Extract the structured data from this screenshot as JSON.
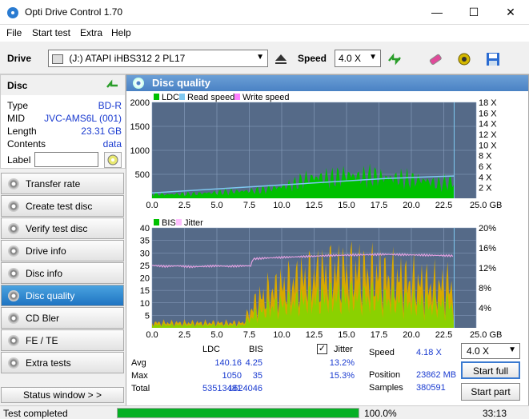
{
  "window": {
    "title": "Opti Drive Control 1.70"
  },
  "menu": [
    "File",
    "Start test",
    "Extra",
    "Help"
  ],
  "toolbar": {
    "drive_label": "Drive",
    "drive_value": "(J:)  ATAPI iHBS312  2 PL17",
    "speed_label": "Speed",
    "speed_value": "4.0 X"
  },
  "disc": {
    "header": "Disc",
    "rows": [
      {
        "k": "Type",
        "v": "BD-R"
      },
      {
        "k": "MID",
        "v": "JVC-AMS6L (001)"
      },
      {
        "k": "Length",
        "v": "23.31 GB"
      },
      {
        "k": "Contents",
        "v": "data"
      }
    ],
    "label_key": "Label",
    "label_value": ""
  },
  "nav": [
    {
      "label": "Transfer rate",
      "active": false
    },
    {
      "label": "Create test disc",
      "active": false
    },
    {
      "label": "Verify test disc",
      "active": false
    },
    {
      "label": "Drive info",
      "active": false
    },
    {
      "label": "Disc info",
      "active": false
    },
    {
      "label": "Disc quality",
      "active": true
    },
    {
      "label": "CD Bler",
      "active": false
    },
    {
      "label": "FE / TE",
      "active": false
    },
    {
      "label": "Extra tests",
      "active": false
    }
  ],
  "status_window_label": "Status window > >",
  "panel_title": "Disc quality",
  "chart_data": [
    {
      "type": "area",
      "legend": [
        "LDC",
        "Read speed",
        "Write speed"
      ],
      "x_ticks": [
        "0.0",
        "2.5",
        "5.0",
        "7.5",
        "10.0",
        "12.5",
        "15.0",
        "17.5",
        "20.0",
        "22.5",
        "25.0 GB"
      ],
      "y_ticks_left": [
        "2000",
        "1500",
        "1000",
        "500"
      ],
      "y_ticks_right": [
        "18 X",
        "16 X",
        "14 X",
        "12 X",
        "10 X",
        "8 X",
        "6 X",
        "4 X",
        "2 X"
      ],
      "xlim": [
        0,
        25
      ],
      "ylim": [
        0,
        2000
      ],
      "y2lim": [
        0,
        18
      ],
      "series": [
        {
          "name": "LDC",
          "color": "#00c000",
          "x": [
            0,
            1,
            2,
            3,
            4,
            5,
            6,
            7,
            8,
            9,
            10,
            11,
            12,
            13,
            14,
            15,
            16,
            17,
            18,
            19,
            20,
            21,
            22,
            23.3
          ],
          "values": [
            100,
            80,
            90,
            90,
            110,
            120,
            140,
            150,
            160,
            200,
            240,
            300,
            420,
            440,
            420,
            500,
            450,
            470,
            430,
            420,
            390,
            380,
            300,
            350
          ]
        },
        {
          "name": "Read speed",
          "color": "#7ec8f0",
          "x": [
            0,
            2,
            4,
            6,
            8,
            10,
            12,
            14,
            16,
            18,
            20,
            22,
            23.3
          ],
          "values": [
            1.0,
            1.3,
            1.6,
            1.9,
            2.2,
            2.5,
            2.8,
            3.1,
            3.4,
            3.7,
            3.9,
            4.1,
            4.18
          ]
        }
      ]
    },
    {
      "type": "area",
      "legend": [
        "BIS",
        "Jitter"
      ],
      "x_ticks": [
        "0.0",
        "2.5",
        "5.0",
        "7.5",
        "10.0",
        "12.5",
        "15.0",
        "17.5",
        "20.0",
        "22.5",
        "25.0 GB"
      ],
      "y_ticks_left": [
        "40",
        "35",
        "30",
        "25",
        "20",
        "15",
        "10",
        "5"
      ],
      "y_ticks_right": [
        "20%",
        "16%",
        "12%",
        "8%",
        "4%"
      ],
      "xlim": [
        0,
        25
      ],
      "ylim": [
        0,
        40
      ],
      "y2lim": [
        0,
        20
      ],
      "series": [
        {
          "name": "BIS",
          "color": "#e0a000",
          "x": [
            0,
            1,
            2,
            3,
            4,
            5,
            6,
            7,
            8,
            9,
            10,
            11,
            12,
            13,
            14,
            15,
            16,
            17,
            18,
            19,
            20,
            21,
            22,
            23.3
          ],
          "values": [
            2,
            2,
            2,
            2,
            2,
            2,
            2,
            2,
            10,
            14,
            16,
            18,
            20,
            21,
            22,
            22,
            22,
            21,
            20,
            19,
            18,
            17,
            16,
            17
          ]
        },
        {
          "name": "Jitter",
          "color": "#d090d0",
          "x": [
            0,
            1,
            2,
            3,
            4,
            5,
            6,
            7,
            7.6,
            7.8,
            9,
            10,
            12,
            14,
            16,
            18,
            20,
            22,
            23.3
          ],
          "values": [
            12.5,
            12.3,
            12.4,
            12.2,
            12.3,
            12.4,
            12.3,
            12.4,
            12.4,
            13.8,
            14.0,
            14.1,
            14.3,
            14.5,
            14.6,
            14.7,
            14.6,
            14.5,
            14.4
          ]
        }
      ]
    }
  ],
  "stats": {
    "col_ldc": "LDC",
    "col_bis": "BIS",
    "jitter_label": "Jitter",
    "jitter_checked": true,
    "rows": [
      {
        "label": "Avg",
        "ldc": "140.16",
        "bis": "4.25",
        "jitter": "13.2%"
      },
      {
        "label": "Max",
        "ldc": "1050",
        "bis": "35",
        "jitter": "15.3%"
      },
      {
        "label": "Total",
        "ldc": "53513481",
        "bis": "1624046",
        "jitter": ""
      }
    ],
    "speed_label": "Speed",
    "speed_value": "4.18 X",
    "position_label": "Position",
    "position_value": "23862 MB",
    "samples_label": "Samples",
    "samples_value": "380591",
    "speed_select": "4.0 X",
    "start_full": "Start full",
    "start_part": "Start part"
  },
  "statusbar": {
    "text": "Test completed",
    "progress": 1.0,
    "percent": "100.0%",
    "time": "33:13"
  }
}
